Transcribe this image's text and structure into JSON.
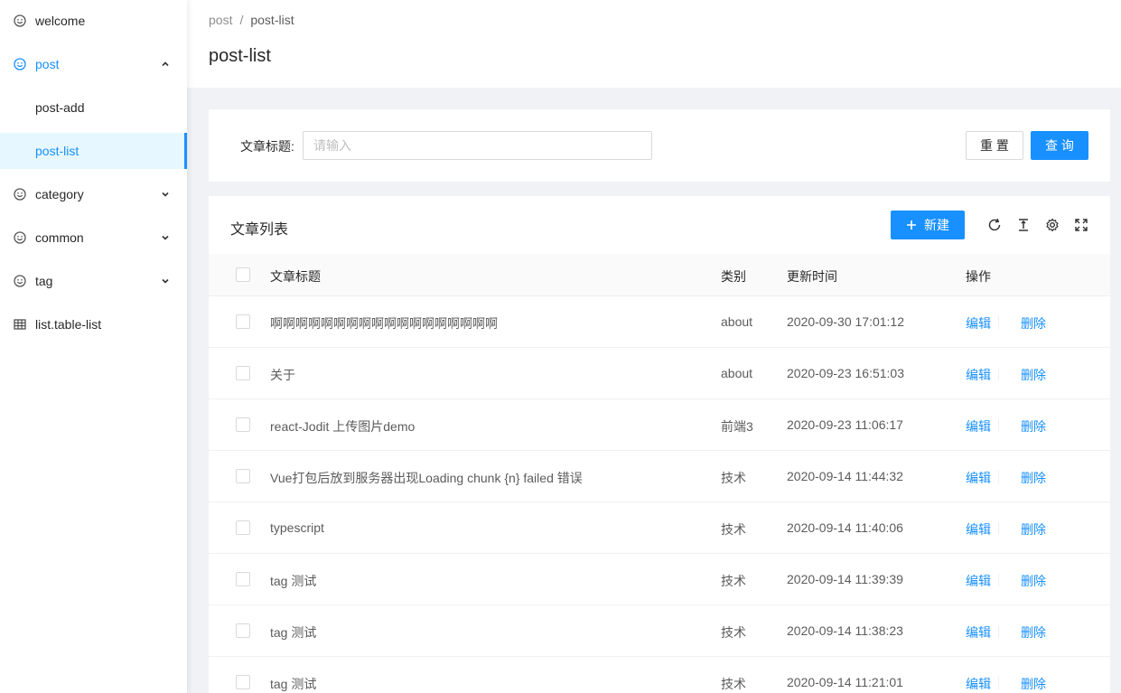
{
  "sidebar": {
    "items": [
      {
        "label": "welcome",
        "icon": "smile-icon"
      },
      {
        "label": "post",
        "icon": "smile-icon",
        "expanded": true
      },
      {
        "label": "post-add"
      },
      {
        "label": "post-list",
        "selected": true
      },
      {
        "label": "category",
        "icon": "smile-icon"
      },
      {
        "label": "common",
        "icon": "smile-icon"
      },
      {
        "label": "tag",
        "icon": "smile-icon"
      },
      {
        "label": "list.table-list",
        "icon": "table-icon"
      }
    ]
  },
  "header": {
    "breadcrumb": [
      "post",
      "post-list"
    ],
    "breadcrumb_sep": "/",
    "title": "post-list"
  },
  "search": {
    "label": "文章标题:",
    "placeholder": "请输入",
    "reset_label": "重 置",
    "query_label": "查 询"
  },
  "table": {
    "title": "文章列表",
    "new_button": "新建",
    "columns": [
      "文章标题",
      "类别",
      "更新时间",
      "操作"
    ],
    "edit_label": "编辑",
    "delete_label": "删除",
    "rows": [
      {
        "title": "啊啊啊啊啊啊啊啊啊啊啊啊啊啊啊啊啊啊",
        "category": "about",
        "updated": "2020-09-30 17:01:12"
      },
      {
        "title": "关于",
        "category": "about",
        "updated": "2020-09-23 16:51:03"
      },
      {
        "title": "react-Jodit 上传图片demo",
        "category": "前端3",
        "updated": "2020-09-23 11:06:17"
      },
      {
        "title": "Vue打包后放到服务器出现Loading chunk {n} failed 错误",
        "category": "技术",
        "updated": "2020-09-14 11:44:32"
      },
      {
        "title": "typescript",
        "category": "技术",
        "updated": "2020-09-14 11:40:06"
      },
      {
        "title": "tag 测试",
        "category": "技术",
        "updated": "2020-09-14 11:39:39"
      },
      {
        "title": "tag 测试",
        "category": "技术",
        "updated": "2020-09-14 11:38:23"
      },
      {
        "title": "tag 测试",
        "category": "技术",
        "updated": "2020-09-14 11:21:01"
      }
    ]
  },
  "colors": {
    "primary": "#1890ff",
    "selected_bg": "#e6f7ff",
    "page_bg": "#f0f2f5"
  }
}
